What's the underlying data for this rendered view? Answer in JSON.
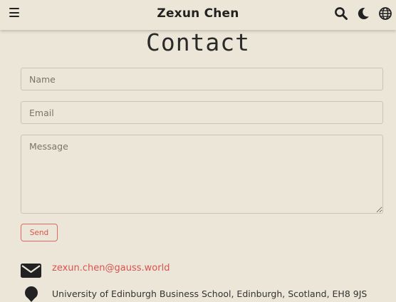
{
  "navbar": {
    "brand": "Zexun Chen",
    "menu_icon": "hamburger-menu-icon",
    "search_icon": "search-icon",
    "theme_icon": "moon-icon",
    "language_icon": "globe-icon"
  },
  "page": {
    "title": "Contact"
  },
  "form": {
    "name_placeholder": "Name",
    "email_placeholder": "Email",
    "message_placeholder": "Message",
    "send_label": "Send"
  },
  "contact": {
    "email": "zexun.chen@gauss.world",
    "email_icon": "envelope-icon",
    "address": "University of Edinburgh Business School, Edinburgh, Scotland, EH8 9JS",
    "address_icon": "location-pin-icon"
  },
  "colors": {
    "background": "#ebe6d7",
    "accent": "#d9534f",
    "text": "#2b2b2b"
  }
}
